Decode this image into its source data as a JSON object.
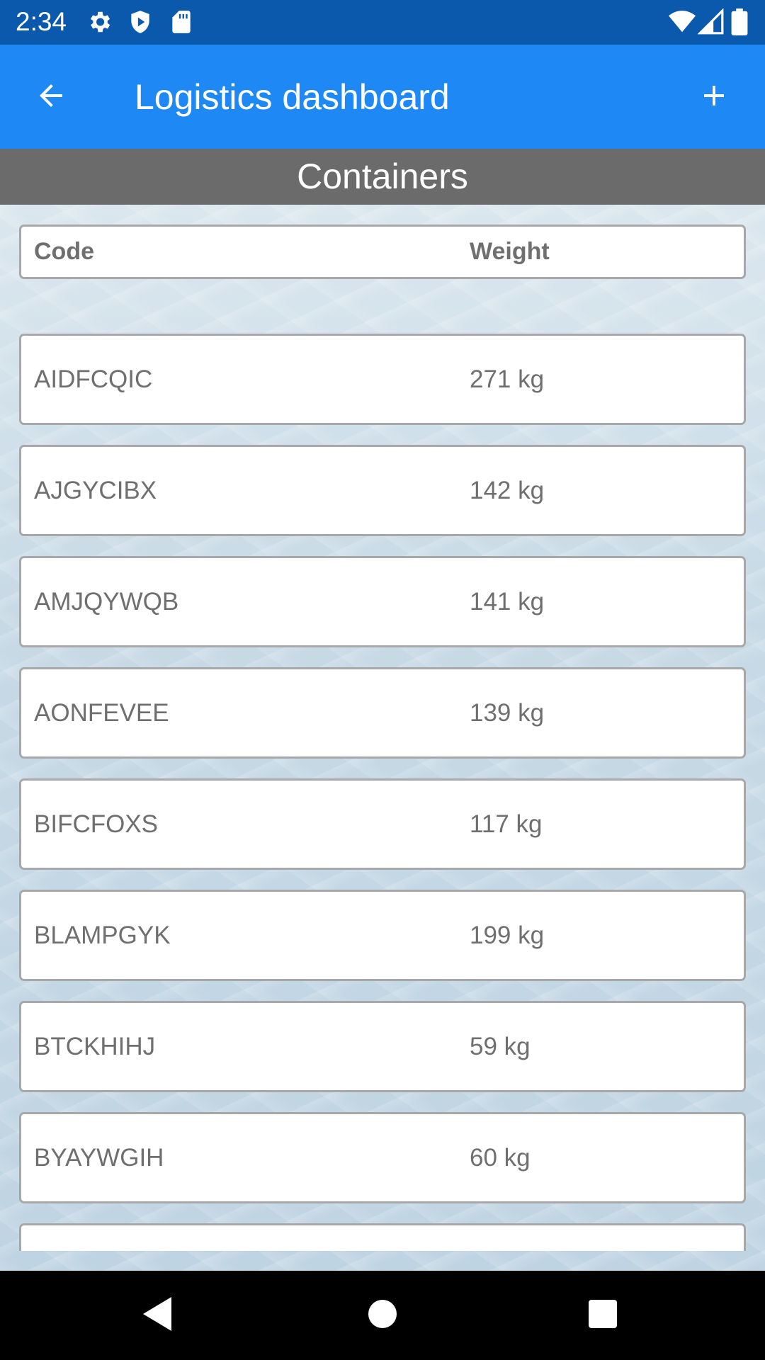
{
  "status_bar": {
    "time": "2:34",
    "icons": [
      "settings-icon",
      "shield-play-icon",
      "sd-card-icon",
      "wifi-icon",
      "signal-icon",
      "battery-icon"
    ]
  },
  "app_bar": {
    "title": "Logistics dashboard",
    "back_icon": "arrow-back-icon",
    "add_icon": "plus-icon"
  },
  "section": {
    "title": "Containers"
  },
  "table": {
    "columns": [
      "Code",
      "Weight"
    ],
    "rows": [
      {
        "code": "AIDFCQIC",
        "weight": "271 kg"
      },
      {
        "code": "AJGYCIBX",
        "weight": "142 kg"
      },
      {
        "code": "AMJQYWQB",
        "weight": "141 kg"
      },
      {
        "code": "AONFEVEE",
        "weight": "139 kg"
      },
      {
        "code": "BIFCFOXS",
        "weight": "117 kg"
      },
      {
        "code": "BLAMPGYK",
        "weight": "199 kg"
      },
      {
        "code": "BTCKHIHJ",
        "weight": "59 kg"
      },
      {
        "code": "BYAYWGIH",
        "weight": "60 kg"
      },
      {
        "code": "",
        "weight": ""
      }
    ]
  },
  "nav_bar": {
    "icons": [
      "back-triangle-icon",
      "home-circle-icon",
      "recents-square-icon"
    ]
  },
  "colors": {
    "status_bar": "#0b59ad",
    "app_bar": "#1e88f5",
    "section_header": "#6b6b6b",
    "card_border": "#a8a8a8",
    "text": "#6f6f6f"
  }
}
